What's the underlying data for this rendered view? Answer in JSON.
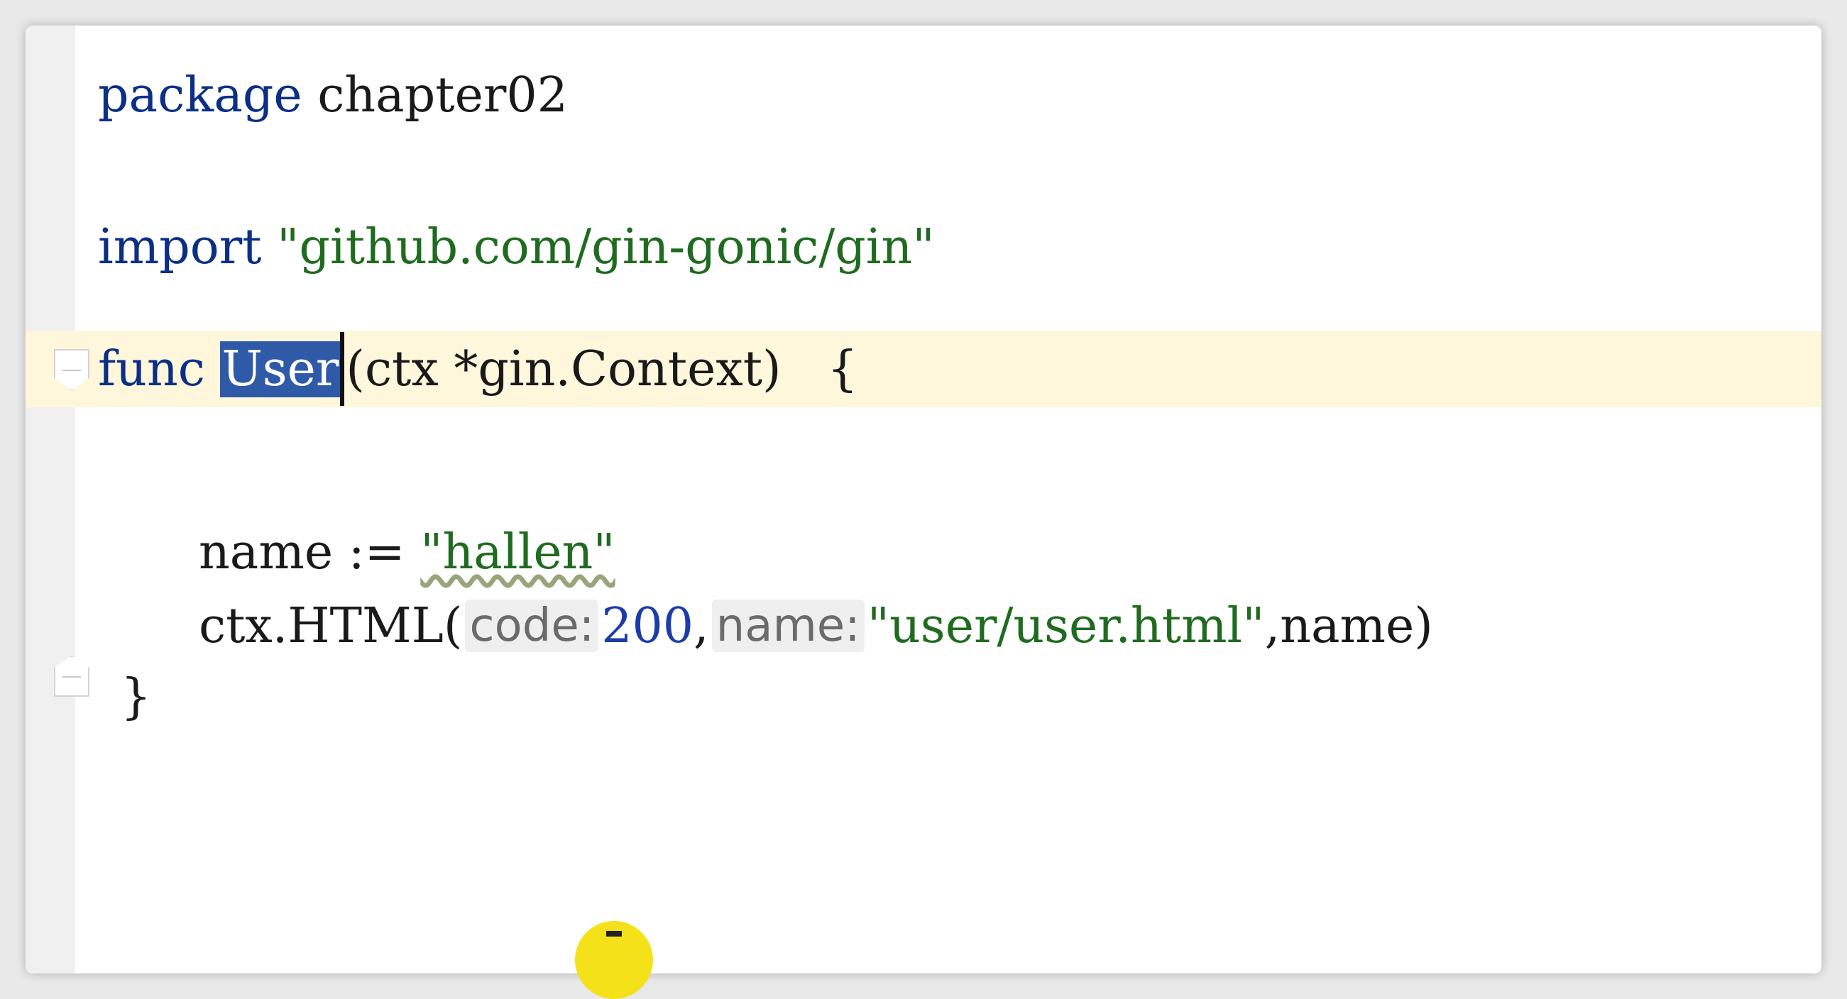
{
  "editor": {
    "lines": {
      "package": {
        "keyword": "package",
        "name": "chapter02"
      },
      "import": {
        "keyword": "import",
        "path": "\"github.com/gin-gonic/gin\""
      },
      "func": {
        "keyword": "func",
        "name": "User",
        "signature": "(ctx *gin.Context)",
        "open_brace": "{"
      },
      "assign": {
        "var": "name",
        "op": ":=",
        "value": "\"hallen\""
      },
      "call": {
        "receiver": "ctx.HTML(",
        "hint_code": "code:",
        "code_value": "200",
        "sep": ",",
        "hint_name": "name:",
        "template": "\"user/user.html\"",
        "tail": ",name)"
      },
      "close": {
        "brace": "}"
      }
    },
    "colors": {
      "keyword": "#0b2f86",
      "string": "#1f6b1f",
      "number": "#1c3ca8",
      "current_line": "#fef7db",
      "selection": "#2f5aa8"
    }
  }
}
